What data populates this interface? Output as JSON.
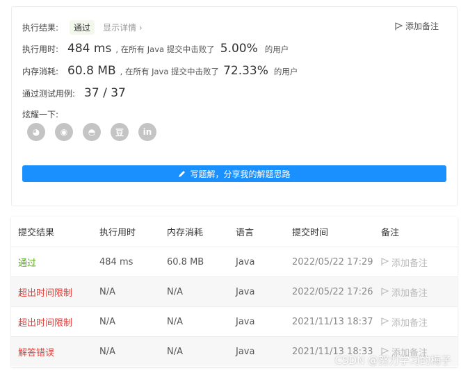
{
  "result_card": {
    "status_label": "执行结果:",
    "status_value": "通过",
    "detail_link": "显示详情 ›",
    "add_note": "添加备注",
    "runtime_label": "执行用时:",
    "runtime_value": "484 ms",
    "runtime_mid": ", 在所有 Java 提交中击败了",
    "runtime_pct": "5.00%",
    "runtime_tail": "的用户",
    "memory_label": "内存消耗:",
    "memory_value": "60.8 MB",
    "memory_mid": ", 在所有 Java 提交中击败了",
    "memory_pct": "72.33%",
    "memory_tail": "的用户",
    "tests_label": "通过测试用例:",
    "tests_value": "37 / 37",
    "share_label": "炫耀一下:",
    "share_icons": [
      "wechat-icon",
      "weibo-icon",
      "qq-icon",
      "douban-icon",
      "linkedin-icon"
    ],
    "share_glyphs": [
      "◕",
      "◉",
      "◓",
      "豆",
      "in"
    ],
    "write_button": "写题解，分享我的解题思路"
  },
  "submissions": {
    "headers": [
      "提交结果",
      "执行用时",
      "内存消耗",
      "语言",
      "提交时间",
      "备注"
    ],
    "rows": [
      {
        "result": "通过",
        "status": "pass",
        "runtime": "484 ms",
        "memory": "60.8 MB",
        "lang": "Java",
        "time": "2022/05/22 17:29",
        "note": "添加备注"
      },
      {
        "result": "超出时间限制",
        "status": "fail",
        "runtime": "N/A",
        "memory": "N/A",
        "lang": "Java",
        "time": "2022/05/22 17:26",
        "note": "添加备注"
      },
      {
        "result": "超出时间限制",
        "status": "fail",
        "runtime": "N/A",
        "memory": "N/A",
        "lang": "Java",
        "time": "2021/11/13 18:37",
        "note": "添加备注"
      },
      {
        "result": "解答错误",
        "status": "fail",
        "runtime": "N/A",
        "memory": "N/A",
        "lang": "Java",
        "time": "2021/11/13 18:33",
        "note": "添加备注"
      }
    ]
  },
  "watermark": "CSDN @努力学习的梅子",
  "colors": {
    "accent": "#1a90ff",
    "pass": "#5aa71d",
    "fail": "#e0403b"
  }
}
